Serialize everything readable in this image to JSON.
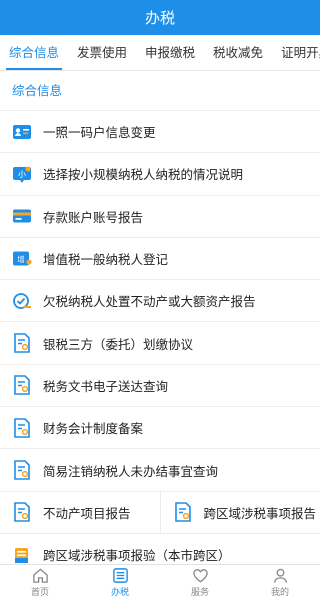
{
  "header": {
    "title": "办税"
  },
  "tabs": [
    {
      "label": "综合信息",
      "active": true
    },
    {
      "label": "发票使用"
    },
    {
      "label": "申报缴税"
    },
    {
      "label": "税收减免"
    },
    {
      "label": "证明开具"
    }
  ],
  "section": {
    "title": "综合信息"
  },
  "items": [
    {
      "label": "一照一码户信息变更",
      "icon": "id-card-icon"
    },
    {
      "label": "选择按小规模纳税人纳税的情况说明",
      "icon": "small-scale-icon"
    },
    {
      "label": "存款账户账号报告",
      "icon": "bank-card-icon"
    },
    {
      "label": "增值税一般纳税人登记",
      "icon": "vat-icon"
    },
    {
      "label": "欠税纳税人处置不动产或大额资产报告",
      "icon": "asset-check-icon"
    },
    {
      "label": "银税三方（委托）划缴协议",
      "icon": "document-icon"
    },
    {
      "label": "税务文书电子送达查询",
      "icon": "document-icon"
    },
    {
      "label": "财务会计制度备案",
      "icon": "document-icon"
    },
    {
      "label": "简易注销纳税人未办结事宜查询",
      "icon": "document-icon"
    }
  ],
  "split_row": [
    {
      "label": "不动产项目报告",
      "icon": "document-icon"
    },
    {
      "label": "跨区域涉税事项报告",
      "icon": "document-icon"
    }
  ],
  "last_item": {
    "label": "跨区域涉税事项报验（本市跨区）",
    "icon": "folder-icon"
  },
  "tabbar": [
    {
      "label": "首页",
      "icon": "home-icon"
    },
    {
      "label": "办税",
      "icon": "list-icon",
      "active": true
    },
    {
      "label": "服务",
      "icon": "heart-icon"
    },
    {
      "label": "我的",
      "icon": "user-icon"
    }
  ],
  "colors": {
    "primary": "#1e8ee8",
    "accent_orange": "#f5a623"
  }
}
